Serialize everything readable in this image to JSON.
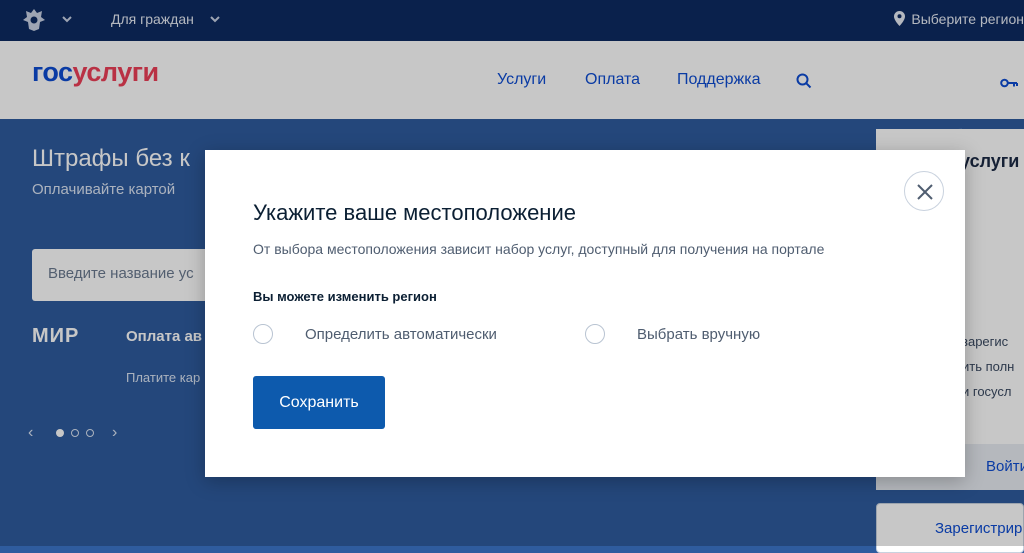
{
  "topbar": {
    "for_citizens": "Для граждан",
    "region": "Выберите регион"
  },
  "header": {
    "logo_part1": "гос",
    "logo_part2": "услуги",
    "nav": [
      "Услуги",
      "Оплата",
      "Поддержка"
    ]
  },
  "hero": {
    "title": "Штрафы без к",
    "subtitle": "Оплачивайте картой",
    "search_placeholder": "Введите название ус",
    "mir": "МИР",
    "promo_title": "Оплата ав",
    "promo_text": "Платите кар"
  },
  "login_card": {
    "brand": "услуги",
    "lines": [
      "зарегис",
      "ить полн",
      "и госусл"
    ],
    "login": "Войти",
    "register": "Зарегистрир"
  },
  "modal": {
    "title": "Укажите ваше местоположение",
    "description": "От выбора местоположения зависит набор услуг, доступный для получения на портале",
    "label": "Вы можете изменить регион",
    "options": [
      "Определить автоматически",
      "Выбрать вручную"
    ],
    "save": "Сохранить"
  },
  "colors": {
    "topbar": "#0e2b62",
    "main_bg": "#2f5c9e",
    "accent_blue": "#0d4cd3",
    "logo_red": "#ee3f58",
    "save_button": "#0d5aad"
  },
  "icons": [
    "coat-of-arms-icon",
    "chevron-down-icon",
    "location-pin-icon",
    "search-icon",
    "key-icon",
    "close-icon",
    "chevron-left-icon",
    "chevron-right-icon"
  ]
}
